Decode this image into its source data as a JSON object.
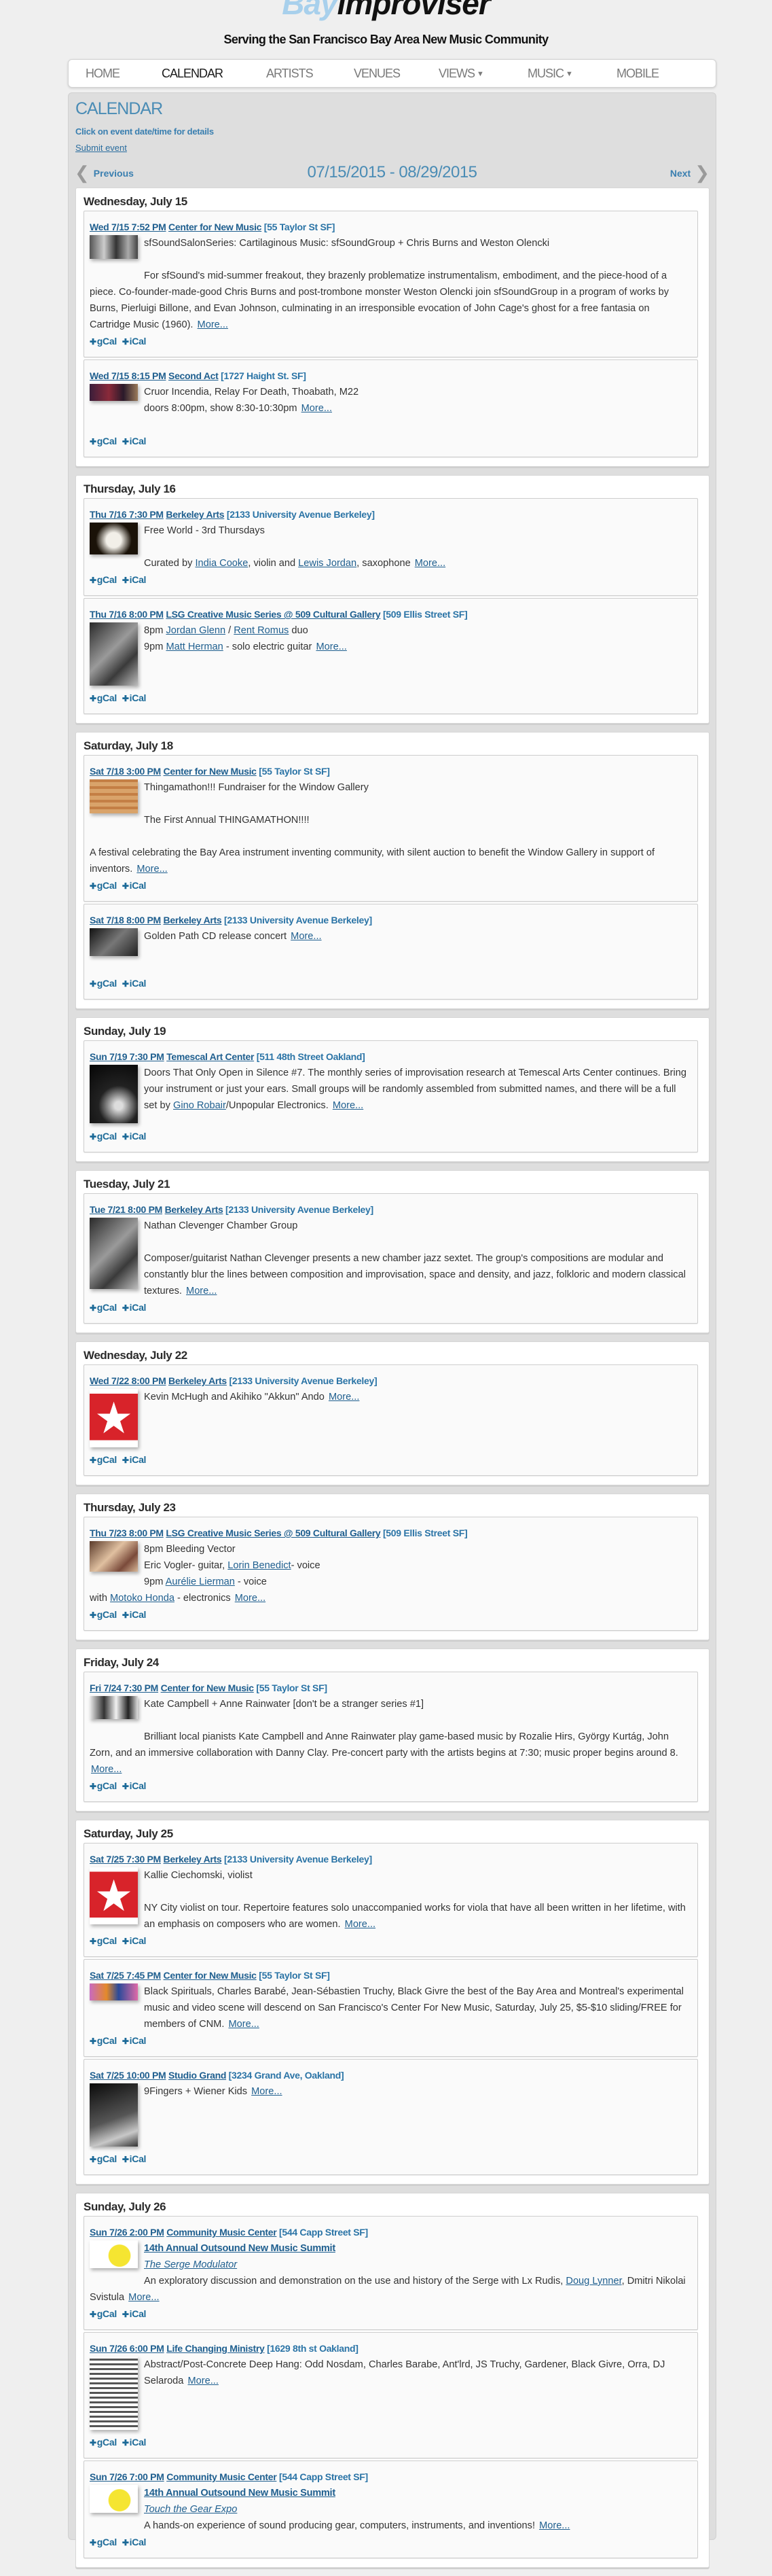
{
  "logo": {
    "part1": "Bay",
    "part2": "improviser"
  },
  "tagline": "Serving the San Francisco Bay Area New Music Community",
  "nav": [
    {
      "label": "HOME"
    },
    {
      "label": "CALENDAR",
      "active": true
    },
    {
      "label": "ARTISTS"
    },
    {
      "label": "VENUES"
    },
    {
      "label": "VIEWS",
      "dropdown": true
    },
    {
      "label": "MUSIC",
      "dropdown": true
    },
    {
      "label": "MOBILE"
    }
  ],
  "calendar": {
    "title": "CALENDAR",
    "hint": "Click on event date/time for details",
    "submit": "Submit event",
    "previous": "Previous",
    "next": "Next",
    "range": "07/15/2015 - 08/29/2015",
    "gcal": "gCal",
    "ical": "iCal"
  },
  "days": [
    {
      "heading": "Wednesday, July 15",
      "events": [
        {
          "datetime": "Wed 7/15 7:52 PM",
          "venue": "Center for New Music",
          "address": "[55 Taylor St SF]",
          "lines": [
            [
              "sfSoundSalonSeries: Cartilaginous Music: sfSoundGroup + Chris Burns and Weston Olencki"
            ],
            [],
            [
              "For sfSound's mid-summer freakout, they brazenly problematize instrumentalism, embodiment, and the piece-hood of a piece. Co-founder-made-good Chris Burns and post-trombone monster Weston Olencki join sfSoundGroup in a program of works by Burns, Pierluigi Billone, and Evan Johnson, culminating in an irresponsible evocation of John Cage's ghost for a free fantasia on Cartridge Music (1960). ",
              {
                "text": "More...",
                "link": true,
                "more": true
              }
            ]
          ]
        },
        {
          "datetime": "Wed 7/15 8:15 PM",
          "venue": "Second Act",
          "address": "[1727 Haight St. SF]",
          "lines": [
            [
              "Cruor Incendia, Relay For Death, Thoabath, M22"
            ],
            [
              "doors 8:00pm, show 8:30-10:30pm ",
              {
                "text": "More...",
                "link": true,
                "more": true
              }
            ],
            []
          ]
        }
      ]
    },
    {
      "heading": "Thursday, July 16",
      "events": [
        {
          "datetime": "Thu 7/16 7:30 PM",
          "venue": "Berkeley Arts",
          "address": "[2133 University Avenue Berkeley]",
          "lines": [
            [
              "Free World - 3rd Thursdays"
            ],
            [],
            [
              "Curated by ",
              {
                "text": "India Cooke",
                "link": true
              },
              ", violin and ",
              {
                "text": "Lewis Jordan",
                "link": true
              },
              ", saxophone ",
              {
                "text": "More...",
                "link": true,
                "more": true
              }
            ]
          ]
        },
        {
          "datetime": "Thu 7/16 8:00 PM",
          "venue": "LSG Creative Music Series @ 509 Cultural Gallery",
          "address": "[509 Ellis Street SF]",
          "lines": [
            [
              "8pm ",
              {
                "text": "Jordan Glenn",
                "link": true
              },
              " / ",
              {
                "text": "Rent Romus",
                "link": true
              },
              " duo"
            ],
            [
              "9pm ",
              {
                "text": "Matt Herman",
                "link": true
              },
              " - solo electric guitar ",
              {
                "text": "More...",
                "link": true,
                "more": true
              }
            ]
          ]
        }
      ]
    },
    {
      "heading": "Saturday, July 18",
      "events": [
        {
          "datetime": "Sat 7/18 3:00 PM",
          "venue": "Center for New Music",
          "address": "[55 Taylor St SF]",
          "lines": [
            [
              "Thingamathon!!! Fundraiser for the Window Gallery"
            ],
            [],
            [
              "The First Annual THINGAMATHON!!!!"
            ],
            [],
            [
              "A festival celebrating the Bay Area instrument inventing community, with silent auction to benefit the Window Gallery in support of inventors. ",
              {
                "text": "More...",
                "link": true,
                "more": true
              }
            ]
          ]
        },
        {
          "datetime": "Sat 7/18 8:00 PM",
          "venue": "Berkeley Arts",
          "address": "[2133 University Avenue Berkeley]",
          "lines": [
            [
              "Golden Path CD release concert ",
              {
                "text": "More...",
                "link": true,
                "more": true
              }
            ]
          ]
        }
      ]
    },
    {
      "heading": "Sunday, July 19",
      "events": [
        {
          "datetime": "Sun 7/19 7:30 PM",
          "venue": "Temescal Art Center",
          "address": "[511 48th Street Oakland]",
          "lines": [
            [
              "Doors That Only Open in Silence #7. The monthly series of improvisation research at Temescal Arts Center continues. Bring your instrument or just your ears. Small groups will be randomly assembled from submitted names, and there will be a full set by ",
              {
                "text": "Gino Robair",
                "link": true
              },
              "/Unpopular Electronics. ",
              {
                "text": "More...",
                "link": true,
                "more": true
              }
            ]
          ]
        }
      ]
    },
    {
      "heading": "Tuesday, July 21",
      "events": [
        {
          "datetime": "Tue 7/21 8:00 PM",
          "venue": "Berkeley Arts",
          "address": "[2133 University Avenue Berkeley]",
          "lines": [
            [
              "Nathan Clevenger Chamber Group"
            ],
            [],
            [
              "Composer/guitarist Nathan Clevenger presents a new chamber jazz sextet. The group's compositions are modular and constantly blur the lines between composition and improvisation, space and density, and jazz, folkloric and modern classical textures. ",
              {
                "text": "More...",
                "link": true,
                "more": true
              }
            ]
          ]
        }
      ]
    },
    {
      "heading": "Wednesday, July 22",
      "events": [
        {
          "datetime": "Wed 7/22 8:00 PM",
          "venue": "Berkeley Arts",
          "address": "[2133 University Avenue Berkeley]",
          "lines": [
            [
              "Kevin McHugh and Akihiko \"Akkun\" Ando ",
              {
                "text": "More...",
                "link": true,
                "more": true
              }
            ]
          ]
        }
      ]
    },
    {
      "heading": "Thursday, July 23",
      "events": [
        {
          "datetime": "Thu 7/23 8:00 PM",
          "venue": "LSG Creative Music Series @ 509 Cultural Gallery",
          "address": "[509 Ellis Street SF]",
          "lines": [
            [
              "8pm Bleeding Vector"
            ],
            [
              "Eric Vogler- guitar, ",
              {
                "text": "Lorin Benedict",
                "link": true
              },
              "- voice"
            ],
            [
              "9pm ",
              {
                "text": "Aurélie Lierman",
                "link": true
              },
              " - voice"
            ],
            [
              "with ",
              {
                "text": "Motoko Honda",
                "link": true
              },
              " - electronics ",
              {
                "text": "More...",
                "link": true,
                "more": true
              }
            ]
          ]
        }
      ]
    },
    {
      "heading": "Friday, July 24",
      "events": [
        {
          "datetime": "Fri 7/24 7:30 PM",
          "venue": "Center for New Music",
          "address": "[55 Taylor St SF]",
          "lines": [
            [
              "Kate Campbell + Anne Rainwater [don't be a stranger series #1]"
            ],
            [],
            [
              "Brilliant local pianists Kate Campbell and Anne Rainwater play game-based music by Rozalie Hirs, György Kurtág, John Zorn, and an immersive collaboration with Danny Clay. Pre-concert party with the artists begins at 7:30; music proper begins around 8. ",
              {
                "text": "More...",
                "link": true,
                "more": true
              }
            ]
          ]
        }
      ]
    },
    {
      "heading": "Saturday, July 25",
      "events": [
        {
          "datetime": "Sat 7/25 7:30 PM",
          "venue": "Berkeley Arts",
          "address": "[2133 University Avenue Berkeley]",
          "lines": [
            [
              "Kallie Ciechomski, violist"
            ],
            [],
            [
              "NY City violist on tour. Repertoire features solo unaccompanied works for viola that have all been written in her lifetime, with an emphasis on composers who are women. ",
              {
                "text": "More...",
                "link": true,
                "more": true
              }
            ]
          ]
        },
        {
          "datetime": "Sat 7/25 7:45 PM",
          "venue": "Center for New Music",
          "address": "[55 Taylor St SF]",
          "lines": [
            [
              "Black Spirituals, Charles Barabé, Jean-Sébastien Truchy, Black Givre the best of the Bay Area and Montreal's experimental music and video scene will descend on San Francisco's Center For New Music, Saturday, July 25, $5-$10 sliding/FREE for members of CNM. ",
              {
                "text": "More...",
                "link": true,
                "more": true
              }
            ]
          ]
        },
        {
          "datetime": "Sat 7/25 10:00 PM",
          "venue": "Studio Grand",
          "address": "[3234 Grand Ave, Oakland]",
          "lines": [
            [
              "9Fingers + Wiener Kids ",
              {
                "text": "More...",
                "link": true,
                "more": true
              }
            ]
          ]
        }
      ]
    },
    {
      "heading": "Sunday, July 26",
      "events": [
        {
          "datetime": "Sun 7/26 2:00 PM",
          "venue": "Community Music Center",
          "address": "[544 Capp Street SF]",
          "lines": [
            [
              {
                "text": "14th Annual Outsound New Music Summit",
                "link": true,
                "style": "strong"
              }
            ],
            [
              {
                "text": "The Serge Modulator",
                "link": true,
                "style": "em"
              }
            ],
            [
              "An exploratory discussion and demonstration on the use and history of the Serge with Lx Rudis, ",
              {
                "text": "Doug Lynner",
                "link": true
              },
              ", Dmitri Nikolai Svistula ",
              {
                "text": "More...",
                "link": true,
                "more": true
              }
            ]
          ]
        },
        {
          "datetime": "Sun 7/26 6:00 PM",
          "venue": "Life Changing Ministry",
          "address": "[1629 8th st Oakland]",
          "lines": [
            [
              "Abstract/Post-Concrete Deep Hang: Odd Nosdam, Charles Barabe, Ant'lrd, JS Truchy, Gardener, Black Givre, Orra, DJ Selaroda ",
              {
                "text": "More...",
                "link": true,
                "more": true
              }
            ]
          ]
        },
        {
          "datetime": "Sun 7/26 7:00 PM",
          "venue": "Community Music Center",
          "address": "[544 Capp Street SF]",
          "lines": [
            [
              {
                "text": "14th Annual Outsound New Music Summit",
                "link": true,
                "style": "strong"
              }
            ],
            [
              {
                "text": "Touch the Gear Expo",
                "link": true,
                "style": "em"
              }
            ],
            [
              "A hands-on experience of sound producing gear, computers, instruments, and inventions! ",
              {
                "text": "More...",
                "link": true,
                "more": true
              }
            ]
          ]
        }
      ]
    }
  ],
  "colors": {
    "accent": "#4a8cb5",
    "link": "#1f5f8f",
    "page_bg": "#efefef",
    "panel_bg": "#dedede"
  }
}
